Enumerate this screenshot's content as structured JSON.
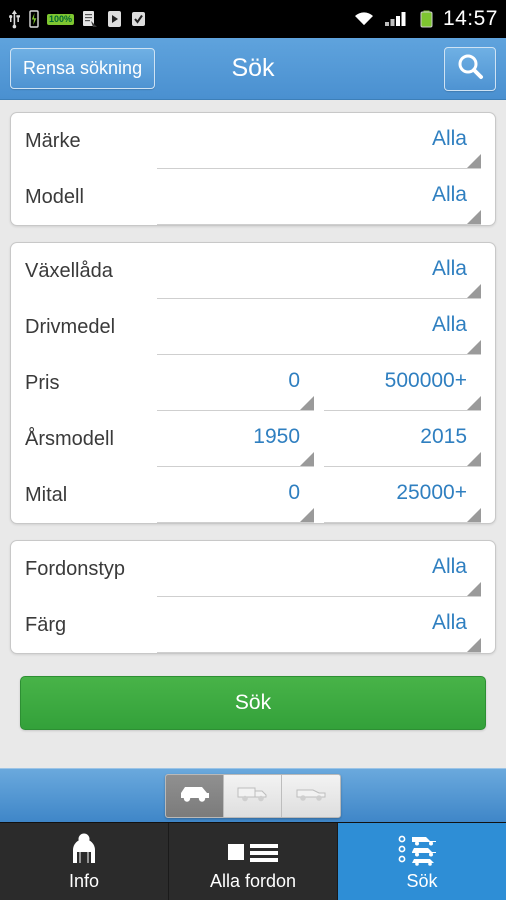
{
  "statusbar": {
    "icons_left": [
      "usb-icon",
      "battery-charge-icon",
      "battery-pct-badge",
      "document-icon",
      "play-store-icon",
      "checkbox-app-icon"
    ],
    "battery_percent": "100%",
    "icons_right": [
      "wifi-icon",
      "signal-icon",
      "battery-icon"
    ],
    "clock": "14:57"
  },
  "titlebar": {
    "clear_label": "Rensa sökning",
    "title": "Sök",
    "search_icon": "search-icon"
  },
  "form": {
    "groups": [
      {
        "rows": [
          {
            "label": "Märke",
            "fields": [
              {
                "value": "Alla"
              }
            ]
          },
          {
            "label": "Modell",
            "fields": [
              {
                "value": "Alla"
              }
            ]
          }
        ]
      },
      {
        "rows": [
          {
            "label": "Växellåda",
            "fields": [
              {
                "value": "Alla"
              }
            ]
          },
          {
            "label": "Drivmedel",
            "fields": [
              {
                "value": "Alla"
              }
            ]
          },
          {
            "label": "Pris",
            "fields": [
              {
                "value": "0"
              },
              {
                "value": "500000+"
              }
            ]
          },
          {
            "label": "Årsmodell",
            "fields": [
              {
                "value": "1950"
              },
              {
                "value": "2015"
              }
            ]
          },
          {
            "label": "Mital",
            "fields": [
              {
                "value": "0"
              },
              {
                "value": "25000+"
              }
            ]
          }
        ]
      },
      {
        "rows": [
          {
            "label": "Fordonstyp",
            "fields": [
              {
                "value": "Alla"
              }
            ]
          },
          {
            "label": "Färg",
            "fields": [
              {
                "value": "Alla"
              }
            ]
          }
        ]
      }
    ]
  },
  "cta": {
    "label": "Sök"
  },
  "typestrip": {
    "items": [
      {
        "name": "car-icon",
        "selected": true
      },
      {
        "name": "truck-icon",
        "selected": false
      },
      {
        "name": "van-icon",
        "selected": false
      }
    ]
  },
  "bottomnav": {
    "items": [
      {
        "label": "Info",
        "icon": "info-person-icon",
        "active": false
      },
      {
        "label": "Alla fordon",
        "icon": "list-icon",
        "active": false
      },
      {
        "label": "Sök",
        "icon": "search-vehicles-icon",
        "active": true
      }
    ]
  },
  "colors": {
    "accent_blue": "#2f7fc0",
    "titlebar_blue": "#4a90d0",
    "cta_green": "#33a13a",
    "nav_active": "#2e8ed6",
    "nav_bg": "#2b2b2b"
  }
}
